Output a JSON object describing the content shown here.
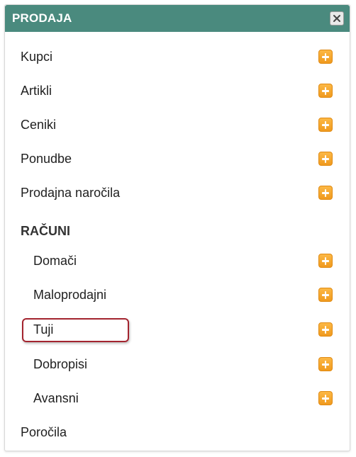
{
  "panel": {
    "title": "PRODAJA",
    "close_icon": "close-icon",
    "add_icon": "plus-icon",
    "accent_color": "#4a8a7e",
    "add_color": "#f5a623"
  },
  "menu": {
    "kupci": "Kupci",
    "artikli": "Artikli",
    "ceniki": "Ceniki",
    "ponudbe": "Ponudbe",
    "prodajna_narocila": "Prodajna naročila",
    "racuni_section": "RAČUNI",
    "domaci": "Domači",
    "maloprodajni": "Maloprodajni",
    "tuji": "Tuji",
    "dobropisi": "Dobropisi",
    "avansni": "Avansni",
    "porocila": "Poročila"
  },
  "highlighted_item": "Tuji"
}
